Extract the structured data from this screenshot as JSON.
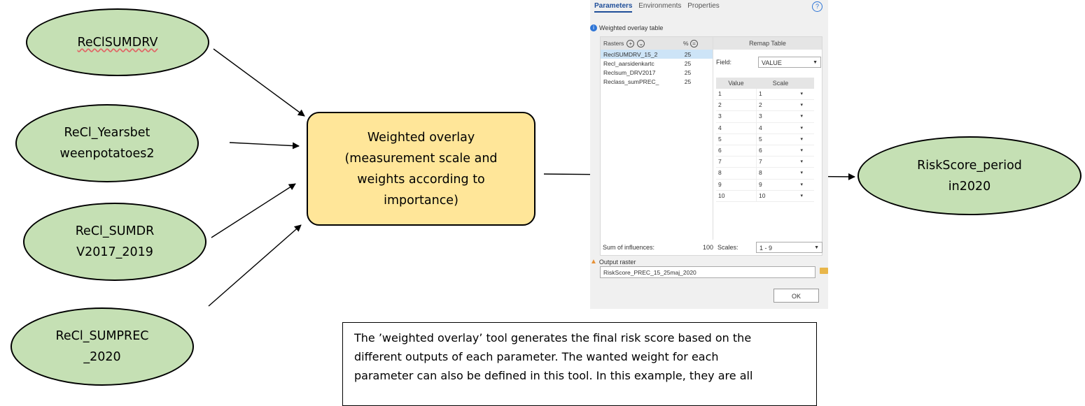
{
  "inputs": [
    {
      "line1": "ReClSUMDRV",
      "line2": ""
    },
    {
      "line1": "ReCl_Yearsbet",
      "line2": "weenpotatoes2"
    },
    {
      "line1": "ReCl_SUMDR",
      "line2": "V2017_2019"
    },
    {
      "line1": "ReCl_SUMPREC",
      "line2": "_2020"
    }
  ],
  "process": {
    "lines": [
      "Weighted overlay",
      "(measurement scale and",
      "weights according to",
      "importance)"
    ]
  },
  "output": {
    "line1": "RiskScore_period",
    "line2": "in2020"
  },
  "dialog": {
    "tabs": [
      "Parameters",
      "Environments",
      "Properties"
    ],
    "help_glyph": "?",
    "section_label": "Weighted overlay table",
    "rasters_header": "Rasters",
    "percent_header": "%",
    "rasters": [
      {
        "name": "ReclSUMDRV_15_2",
        "pct": "25"
      },
      {
        "name": "Recl_aarsidenkartc",
        "pct": "25"
      },
      {
        "name": "Reclsum_DRV2017",
        "pct": "25"
      },
      {
        "name": "Reclass_sumPREC_",
        "pct": "25"
      }
    ],
    "remap_header": "Remap Table",
    "field_label": "Field:",
    "field_value": "VALUE",
    "value_header": "Value",
    "scale_header": "Scale",
    "remap_rows": [
      {
        "value": "1",
        "scale": "1"
      },
      {
        "value": "2",
        "scale": "2"
      },
      {
        "value": "3",
        "scale": "3"
      },
      {
        "value": "4",
        "scale": "4"
      },
      {
        "value": "5",
        "scale": "5"
      },
      {
        "value": "6",
        "scale": "6"
      },
      {
        "value": "7",
        "scale": "7"
      },
      {
        "value": "8",
        "scale": "8"
      },
      {
        "value": "9",
        "scale": "9"
      },
      {
        "value": "10",
        "scale": "10"
      }
    ],
    "sum_label": "Sum of influences:",
    "sum_value": "100",
    "scales_label": "Scales:",
    "scales_value": "1 - 9",
    "output_label": "Output raster",
    "output_value": "RiskScore_PREC_15_25maj_2020",
    "ok_label": "OK"
  },
  "description": {
    "lines": [
      "The ’weighted overlay’ tool generates the final risk score based on the",
      "different outputs of each parameter. The wanted weight for each",
      "parameter can also be defined in this tool. In this example, they are all"
    ]
  },
  "colors": {
    "input_fill": "#c5e0b4",
    "process_fill": "#ffe699",
    "accent": "#2e75d6"
  }
}
